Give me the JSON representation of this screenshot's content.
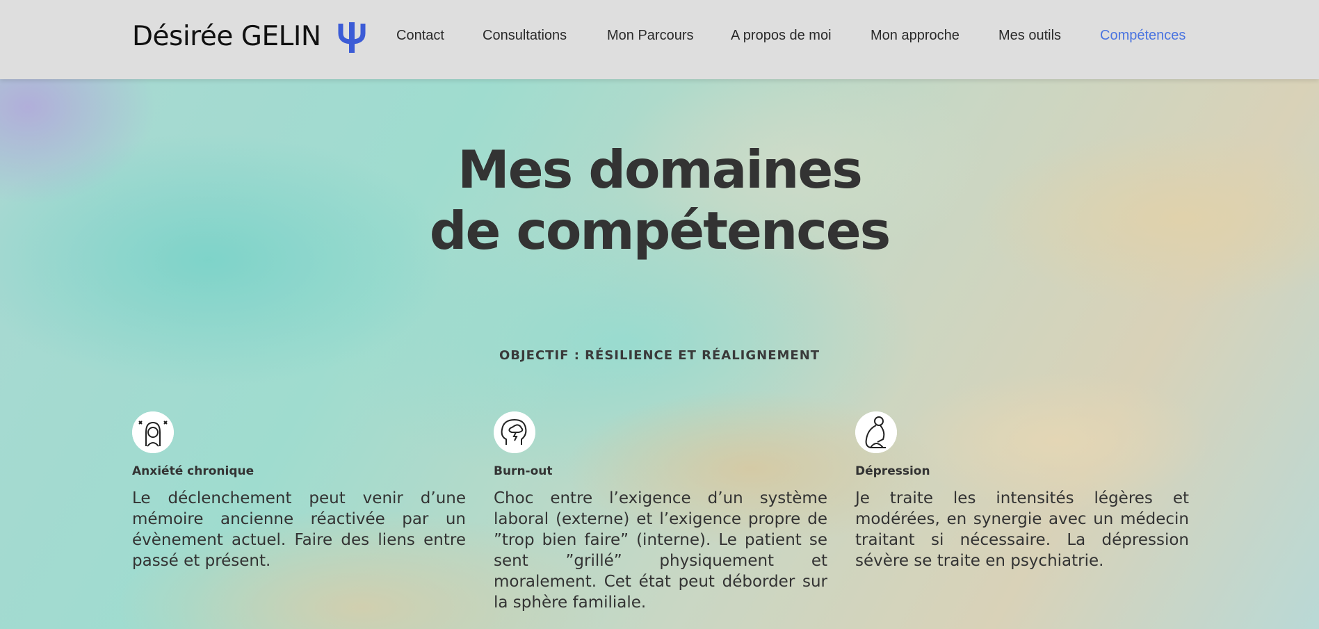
{
  "header": {
    "logo": "Désirée GELIN",
    "logo_icon": "psi-icon",
    "nav": [
      {
        "label": "Contact"
      },
      {
        "label": "Consultations"
      },
      {
        "label": "Mon Parcours"
      },
      {
        "label": "A propos de moi"
      },
      {
        "label": "Mon approche"
      },
      {
        "label": "Mes outils"
      },
      {
        "label": "Compétences",
        "active": true
      }
    ]
  },
  "hero": {
    "title_line1": "Mes domaines",
    "title_line2": "de compétences",
    "subtitle": "OBJECTIF : RÉSILIENCE ET RÉALIGNEMENT"
  },
  "cards": [
    {
      "icon": "anxious-person-icon",
      "title": "Anxiété chronique",
      "text": "Le déclenchement peut venir d’une mémoire ancienne réactivée par un évènement actuel. Faire des liens entre passé et présent."
    },
    {
      "icon": "brain-storm-icon",
      "title": "Burn-out",
      "text": "Choc entre l’exigence d’un système laboral (externe) et l’exigence propre de ”trop bien faire” (interne). Le patient se sent ”grillé” physiquement et moralement. Cet état peut déborder sur la sphère familiale."
    },
    {
      "icon": "sad-sitting-person-icon",
      "title": "Dépression",
      "text": "Je traite les intensités légères et modérées, en synergie avec un médecin traitant si nécessaire. La dépression sévère se traite en psychiatrie."
    }
  ],
  "colors": {
    "header_bg": "#dedede",
    "nav_active": "#4a74e0",
    "psi_icon": "#3b5bd6"
  }
}
